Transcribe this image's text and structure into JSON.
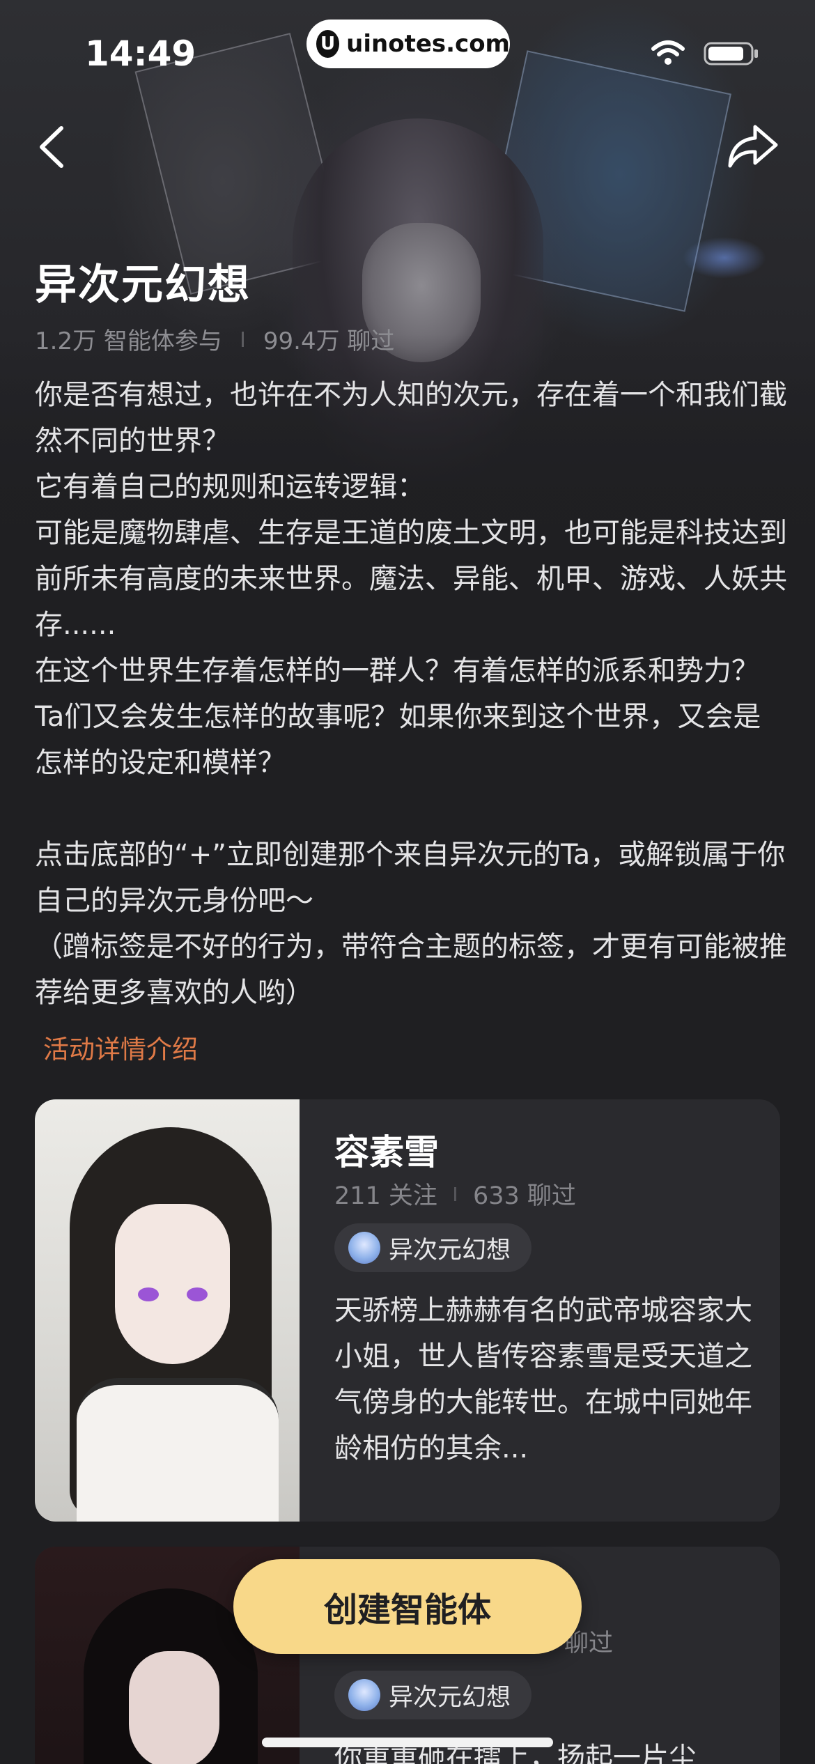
{
  "status_bar": {
    "time": "14:49",
    "watermark": "uinotes.com",
    "watermark_logo": "U"
  },
  "header": {
    "back_icon": "chevron-left-icon",
    "share_icon": "share-arrow-icon"
  },
  "topic": {
    "title": "异次元幻想",
    "participants": "1.2万 智能体参与",
    "chats": "99.4万 聊过",
    "description": "你是否有想过，也许在不为人知的次元，存在着一个和我们截然不同的世界？\n它有着自己的规则和运转逻辑：\n可能是魔物肆虐、生存是王道的废土文明，也可能是科技达到前所未有高度的未来世界。魔法、异能、机甲、游戏、人妖共存......\n在这个世界生存着怎样的一群人？有着怎样的派系和势力？Ta们又会发生怎样的故事呢？如果你来到这个世界，又会是怎样的设定和模样？\n\n点击底部的“+”立即创建那个来自异次元的Ta，或解锁属于你自己的异次元身份吧～\n（蹭标签是不好的行为，带符合主题的标签，才更有可能被推荐给更多喜欢的人哟）",
    "detail_link": "活动详情介绍"
  },
  "characters": [
    {
      "name": "容素雪",
      "followers": "211 关注",
      "chats": "633 聊过",
      "tag": "异次元幻想",
      "description": "天骄榜上赫赫有名的武帝城容家大小姐，世人皆传容素雪是受天道之气傍身的大能转世。在城中同她年龄相仿的其余..."
    },
    {
      "name": "",
      "followers": "",
      "chats": "聊过",
      "tag": "异次元幻想",
      "description": "你重重砸在擂上，扬起一片尘"
    }
  ],
  "create_button": "创建智能体",
  "colors": {
    "background": "#1f1f22",
    "card": "#2a2a2e",
    "accent_link": "#e07a47",
    "create_button": "#f8d889"
  }
}
